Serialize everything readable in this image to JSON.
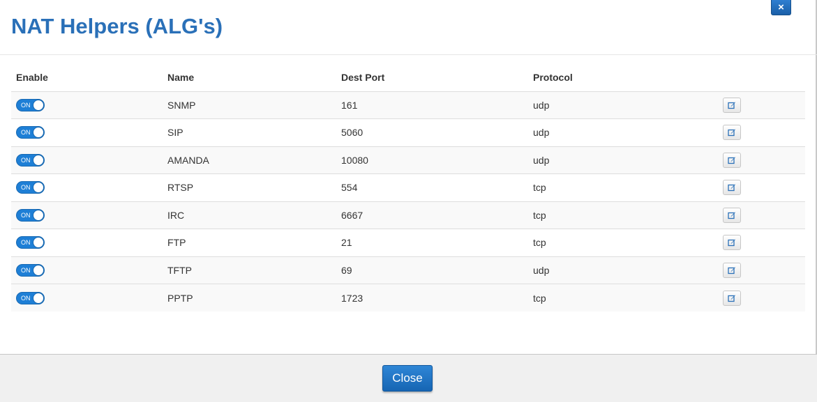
{
  "dialog": {
    "title": "NAT Helpers (ALG's)",
    "close_x_label": "×"
  },
  "table": {
    "headers": {
      "enable": "Enable",
      "name": "Name",
      "dest_port": "Dest Port",
      "protocol": "Protocol"
    },
    "rows": [
      {
        "enabled": "ON",
        "name": "SNMP",
        "dest_port": "161",
        "protocol": "udp"
      },
      {
        "enabled": "ON",
        "name": "SIP",
        "dest_port": "5060",
        "protocol": "udp"
      },
      {
        "enabled": "ON",
        "name": "AMANDA",
        "dest_port": "10080",
        "protocol": "udp"
      },
      {
        "enabled": "ON",
        "name": "RTSP",
        "dest_port": "554",
        "protocol": "tcp"
      },
      {
        "enabled": "ON",
        "name": "IRC",
        "dest_port": "6667",
        "protocol": "tcp"
      },
      {
        "enabled": "ON",
        "name": "FTP",
        "dest_port": "21",
        "protocol": "tcp"
      },
      {
        "enabled": "ON",
        "name": "TFTP",
        "dest_port": "69",
        "protocol": "udp"
      },
      {
        "enabled": "ON",
        "name": "PPTP",
        "dest_port": "1723",
        "protocol": "tcp"
      }
    ],
    "row_action_icon": "edit-icon"
  },
  "footer": {
    "close_label": "Close"
  },
  "colors": {
    "accent": "#2a70b8",
    "toggle_on": "#1e7fd6"
  }
}
